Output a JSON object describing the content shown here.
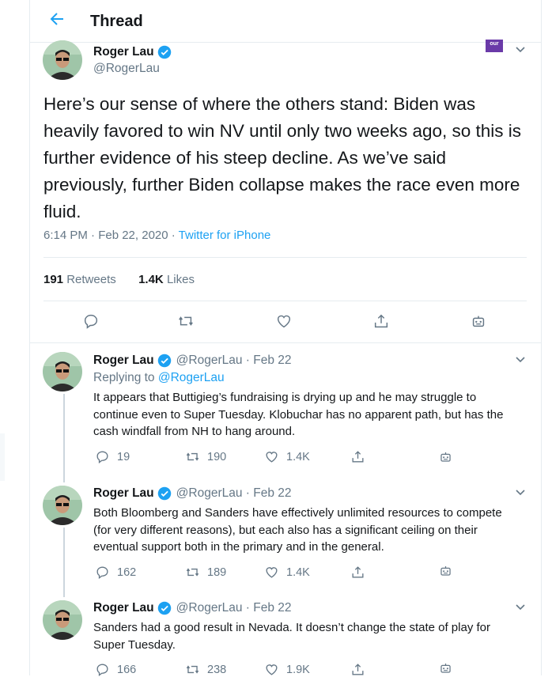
{
  "header": {
    "title": "Thread"
  },
  "main_tweet": {
    "name": "Roger Lau",
    "handle": "@RogerLau",
    "badge": "our",
    "text": "Here’s our sense of where the others stand: Biden was heavily favored to win NV until only two weeks ago, so this is further evidence of his steep decline. As we’ve said previously, further Biden collapse makes the race even more fluid.",
    "time": "6:14 PM · Feb 22, 2020 ·",
    "source": "Twitter for iPhone",
    "retweets": "191",
    "retweets_label": "Retweets",
    "likes": "1.4K",
    "likes_label": "Likes"
  },
  "replies": [
    {
      "name": "Roger Lau",
      "handle_date": "@RogerLau · Feb 22",
      "replying_prefix": "Replying to",
      "replying_to": "@RogerLau",
      "text": "It appears that Buttigieg’s fundraising is drying up and he may struggle to continue even to Super Tuesday. Klobuchar has no apparent path, but has the cash windfall from NH to hang around.",
      "replies": "19",
      "retweets": "190",
      "likes": "1.4K"
    },
    {
      "name": "Roger Lau",
      "handle_date": "@RogerLau · Feb 22",
      "text": "Both Bloomberg and Sanders have effectively unlimited resources to compete (for very different reasons), but each also has a significant ceiling on their eventual support both in the primary and in the general.",
      "replies": "162",
      "retweets": "189",
      "likes": "1.4K"
    },
    {
      "name": "Roger Lau",
      "handle_date": "@RogerLau · Feb 22",
      "text": "Sanders had a good result in Nevada. It doesn’t change the state of play for Super Tuesday.",
      "replies": "166",
      "retweets": "238",
      "likes": "1.9K"
    }
  ],
  "colors": {
    "accent": "#1da1f2",
    "muted": "#657786",
    "text": "#14171a",
    "border": "#e6ecf0"
  }
}
